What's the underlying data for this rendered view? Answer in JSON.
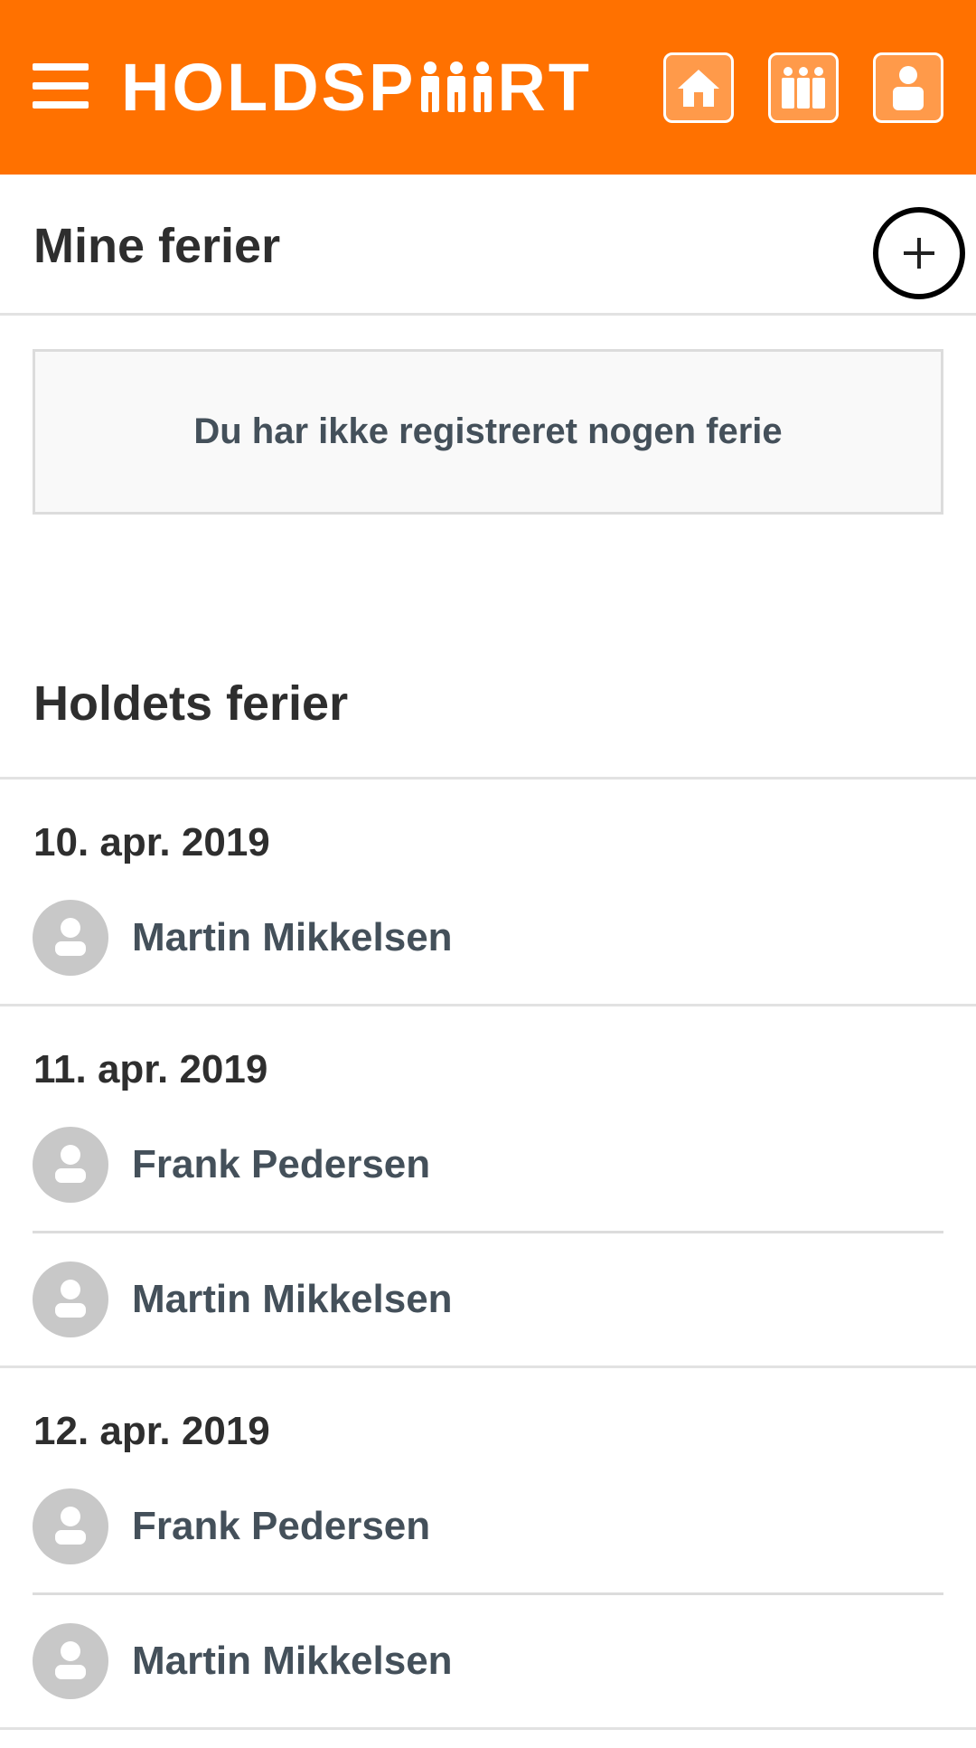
{
  "header": {
    "logo_text_left": "HOLDSP",
    "logo_text_right": "RT",
    "nav": [
      {
        "icon": "home-icon"
      },
      {
        "icon": "team-icon"
      },
      {
        "icon": "profile-icon"
      }
    ],
    "colors": {
      "brand": "#ff7100"
    }
  },
  "mine": {
    "title": "Mine ferier",
    "empty_text": "Du har ikke registreret nogen ferie"
  },
  "holdets": {
    "title": "Holdets ferier",
    "days": [
      {
        "date": "10. apr. 2019",
        "people": [
          "Martin Mikkelsen"
        ]
      },
      {
        "date": "11. apr. 2019",
        "people": [
          "Frank Pedersen",
          "Martin Mikkelsen"
        ]
      },
      {
        "date": "12. apr. 2019",
        "people": [
          "Frank Pedersen",
          "Martin Mikkelsen"
        ]
      }
    ]
  }
}
